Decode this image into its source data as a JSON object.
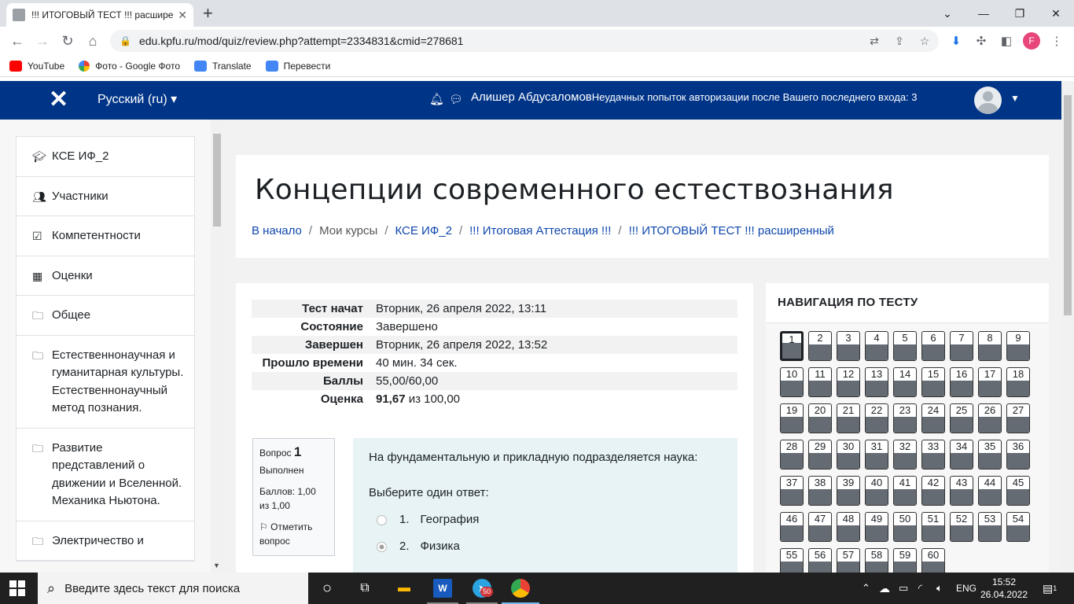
{
  "browser": {
    "tab_title": "!!! ИТОГОВЫЙ ТЕСТ !!! расшире",
    "url": "edu.kpfu.ru/mod/quiz/review.php?attempt=2334831&cmid=278681",
    "profile_letter": "F",
    "bookmarks": [
      "YouTube",
      "Фото - Google Фото",
      "Translate",
      "Перевести"
    ]
  },
  "navbar": {
    "language": "Русский (ru)",
    "user_name": "Алишер Абдусаломов",
    "login_notice": "Неудачных попыток авторизации после Вашего последнего входа: 3"
  },
  "drawer": {
    "items": [
      {
        "icon": "graduation-cap-icon",
        "label": "КСЕ ИФ_2"
      },
      {
        "icon": "users-icon",
        "label": "Участники"
      },
      {
        "icon": "checkbox-icon",
        "label": "Компетентности"
      },
      {
        "icon": "table-icon",
        "label": "Оценки"
      },
      {
        "icon": "folder-icon",
        "label": "Общее"
      },
      {
        "icon": "folder-icon",
        "label": "Естественнонаучная и гуманитарная культуры. Естественнонаучный метод познания."
      },
      {
        "icon": "folder-icon",
        "label": "Развитие представлений о движении и Вселенной. Механика Ньютона."
      },
      {
        "icon": "folder-icon",
        "label": "Электричество и"
      }
    ]
  },
  "header": {
    "course_title": "Концепции современного естествознания",
    "breadcrumbs": [
      {
        "label": "В начало",
        "link": true
      },
      {
        "label": "Мои курсы",
        "link": false
      },
      {
        "label": "КСЕ ИФ_2",
        "link": true
      },
      {
        "label": "!!! Итоговая Аттестация !!!",
        "link": true
      },
      {
        "label": "!!! ИТОГОВЫЙ ТЕСТ !!! расширенный",
        "link": true
      }
    ]
  },
  "summary": [
    {
      "key": "Тест начат",
      "value": "Вторник, 26 апреля 2022, 13:11"
    },
    {
      "key": "Состояние",
      "value": "Завершено"
    },
    {
      "key": "Завершен",
      "value": "Вторник, 26 апреля 2022, 13:52"
    },
    {
      "key": "Прошло времени",
      "value": "40 мин. 34 сек."
    },
    {
      "key": "Баллы",
      "value": "55,00/60,00"
    },
    {
      "key": "Оценка",
      "value_bold": "91,67",
      "value_rest": " из 100,00"
    }
  ],
  "question": {
    "label": "Вопрос",
    "number": "1",
    "state": "Выполнен",
    "marks": "Баллов: 1,00 из 1,00",
    "flag_label": "Отметить вопрос",
    "text": "На фундаментальную и прикладную подразделяется наука:",
    "prompt": "Выберите один ответ:",
    "answers": [
      {
        "num": "1.",
        "text": "География",
        "selected": false
      },
      {
        "num": "2.",
        "text": "Физика",
        "selected": true
      }
    ]
  },
  "quiz_nav": {
    "title": "НАВИГАЦИЯ ПО ТЕСТУ",
    "current": 1,
    "count": 60
  },
  "taskbar": {
    "search_placeholder": "Введите здесь текст для поиска",
    "telegram_badge": "50",
    "language": "ENG",
    "time": "15:52",
    "date": "26.04.2022",
    "notifications": "1"
  }
}
